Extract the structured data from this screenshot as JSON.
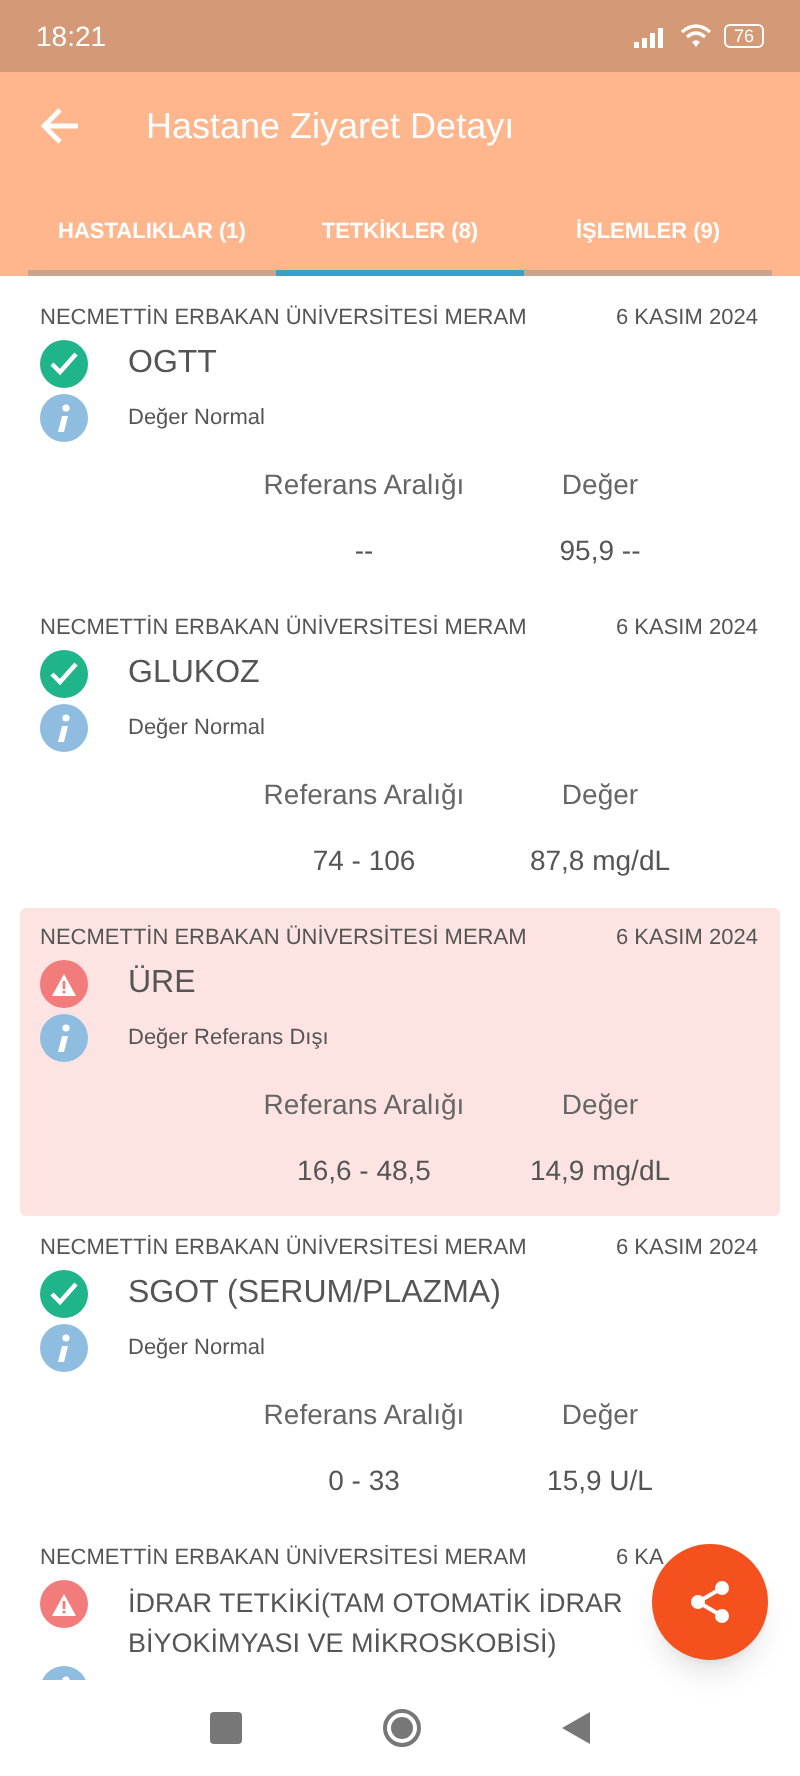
{
  "status_bar": {
    "time": "18:21",
    "battery": "76"
  },
  "header": {
    "title": "Hastane Ziyaret Detayı"
  },
  "tabs": [
    {
      "label": "HASTALIKLAR (1)",
      "selected": false
    },
    {
      "label": "TETKİKLER (8)",
      "selected": true
    },
    {
      "label": "İŞLEMLER (9)",
      "selected": false
    }
  ],
  "tests": [
    {
      "hospital": "NECMETTİN ERBAKAN ÜNİVERSİTESİ MERAM",
      "date": "6 KASIM 2024",
      "name": "OGTT",
      "within_range": true,
      "status": "Değer Normal",
      "range_label": "Referans Aralığı",
      "value_label": "Değer",
      "range": "--",
      "value": "95,9 --"
    },
    {
      "hospital": "NECMETTİN ERBAKAN ÜNİVERSİTESİ MERAM",
      "date": "6 KASIM 2024",
      "name": "GLUKOZ",
      "within_range": true,
      "status": "Değer Normal",
      "range_label": "Referans Aralığı",
      "value_label": "Değer",
      "range": "74 - 106",
      "value": "87,8 mg/dL"
    },
    {
      "hospital": "NECMETTİN ERBAKAN ÜNİVERSİTESİ MERAM",
      "date": "6 KASIM 2024",
      "name": "ÜRE",
      "within_range": false,
      "status": "Değer Referans Dışı",
      "range_label": "Referans Aralığı",
      "value_label": "Değer",
      "range": "16,6 - 48,5",
      "value": "14,9 mg/dL"
    },
    {
      "hospital": "NECMETTİN ERBAKAN ÜNİVERSİTESİ MERAM",
      "date": "6 KASIM 2024",
      "name": "SGOT (SERUM/PLAZMA)",
      "within_range": true,
      "status": "Değer Normal",
      "range_label": "Referans Aralığı",
      "value_label": "Değer",
      "range": "0 - 33",
      "value": "15,9 U/L"
    },
    {
      "hospital": "NECMETTİN ERBAKAN ÜNİVERSİTESİ MERAM",
      "date": "6 KA",
      "name": "İDRAR TETKİKİ(TAM OTOMATİK İDRAR BİYOKİMYASI VE MİKROSKOBİSİ)",
      "within_range": false
    }
  ]
}
